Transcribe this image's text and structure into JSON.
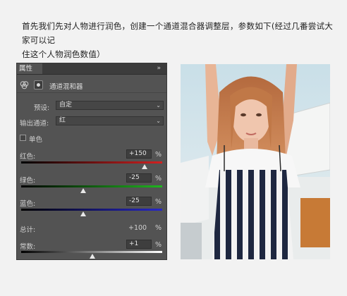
{
  "caption": {
    "line1": "首先我们先对人物进行润色，创建一个通道混合器调整层，参数如下(经过几番尝试大家可以记",
    "line2": "住这个人物润色数值）"
  },
  "panel": {
    "tab_label": "属性",
    "collapse_glyph": "»",
    "adjustment_title": "通道混和器",
    "preset_label": "预设:",
    "preset_value": "自定",
    "output_channel_label": "输出通道:",
    "output_channel_value": "红",
    "monochrome_label": "单色",
    "sliders": [
      {
        "label": "红色:",
        "value": "+150",
        "unit": "%",
        "level": 0.875
      },
      {
        "label": "绿色:",
        "value": "-25",
        "unit": "%",
        "level": 0.4375
      },
      {
        "label": "蓝色:",
        "value": "-25",
        "unit": "%",
        "level": 0.4375
      }
    ],
    "total_label": "总计:",
    "total_value": "+100",
    "total_unit": "%",
    "constant": {
      "label": "常数:",
      "value": "+1",
      "unit": "%",
      "level": 0.505
    }
  },
  "colors": {
    "red_gradient_end": "#d32020",
    "green_gradient_end": "#1fb61f",
    "blue_gradient_end": "#2727c8"
  }
}
